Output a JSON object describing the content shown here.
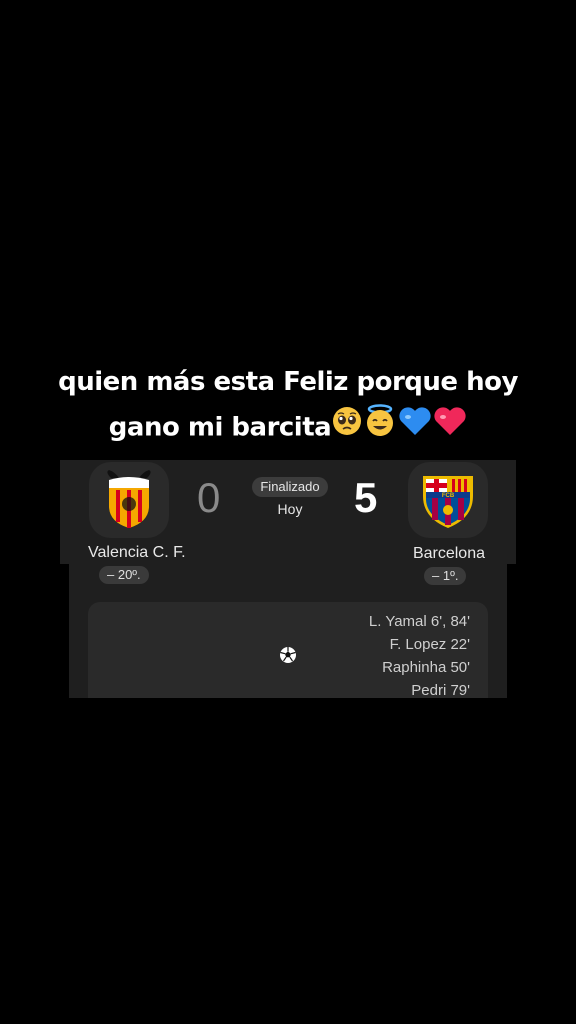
{
  "caption": {
    "line1": "quien más esta Feliz porque hoy",
    "line2": "gano mi barcita",
    "emojis": [
      "pleading-face-icon",
      "smiling-face-with-halo-icon",
      "blue-heart-icon",
      "red-heart-icon"
    ]
  },
  "match": {
    "home": {
      "name": "Valencia C. F.",
      "rank": "– 20º.",
      "crest_text": "VALENCIA C.F.",
      "colors": {
        "primary": "#f5a800",
        "stripe": "#d6001c"
      }
    },
    "away": {
      "name": "Barcelona",
      "rank": "– 1º.",
      "crest_text": "FCB",
      "colors": {
        "primary": "#a50044",
        "secondary": "#004d98",
        "gold": "#edbb00"
      }
    },
    "home_score": "0",
    "away_score": "5",
    "status": "Finalizado",
    "date": "Hoy",
    "scorers": [
      "L. Yamal 6', 84'",
      "F. Lopez 22'",
      "Raphinha 50'",
      "Pedri 79'"
    ]
  }
}
